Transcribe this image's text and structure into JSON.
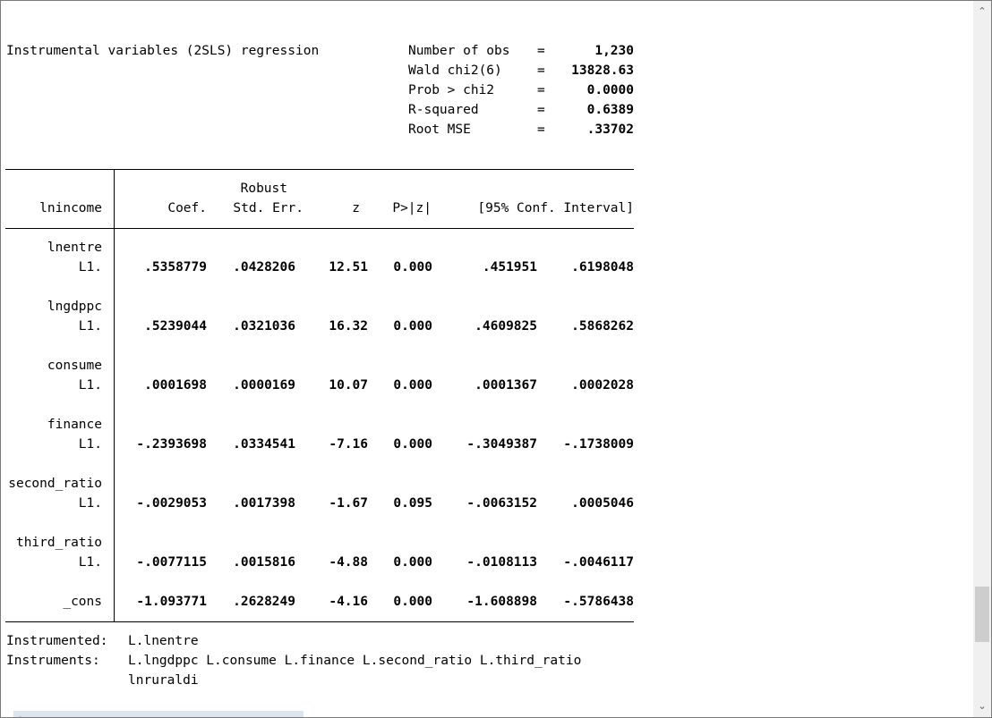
{
  "header": {
    "title": "Instrumental variables (2SLS) regression",
    "stats": [
      {
        "label": "Number of obs",
        "eq": "=",
        "value": "1,230"
      },
      {
        "label": "Wald chi2(6)",
        "eq": "=",
        "value": "13828.63"
      },
      {
        "label": "Prob > chi2",
        "eq": "=",
        "value": "0.0000"
      },
      {
        "label": "R-squared",
        "eq": "=",
        "value": "0.6389"
      },
      {
        "label": "Root MSE",
        "eq": "=",
        "value": ".33702"
      }
    ]
  },
  "table": {
    "depvar": "lnincome",
    "headers": {
      "robust": "Robust",
      "coef": "Coef.",
      "se": "Std. Err.",
      "z": "z",
      "p": "P>|z|",
      "ci": "[95% Conf. Interval]"
    },
    "rows": [
      {
        "var": "lnentre",
        "lag": "L1.",
        "coef": ".5358779",
        "se": ".0428206",
        "z": "12.51",
        "p": "0.000",
        "lo": ".451951",
        "hi": ".6198048"
      },
      {
        "var": "lngdppc",
        "lag": "L1.",
        "coef": ".5239044",
        "se": ".0321036",
        "z": "16.32",
        "p": "0.000",
        "lo": ".4609825",
        "hi": ".5868262"
      },
      {
        "var": "consume",
        "lag": "L1.",
        "coef": ".0001698",
        "se": ".0000169",
        "z": "10.07",
        "p": "0.000",
        "lo": ".0001367",
        "hi": ".0002028"
      },
      {
        "var": "finance",
        "lag": "L1.",
        "coef": "-.2393698",
        "se": ".0334541",
        "z": "-7.16",
        "p": "0.000",
        "lo": "-.3049387",
        "hi": "-.1738009"
      },
      {
        "var": "second_ratio",
        "lag": "L1.",
        "coef": "-.0029053",
        "se": ".0017398",
        "z": "-1.67",
        "p": "0.095",
        "lo": "-.0063152",
        "hi": ".0005046"
      },
      {
        "var": "third_ratio",
        "lag": "L1.",
        "coef": "-.0077115",
        "se": ".0015816",
        "z": "-4.88",
        "p": "0.000",
        "lo": "-.0108113",
        "hi": "-.0046117"
      }
    ],
    "cons": {
      "var": "_cons",
      "coef": "-1.093771",
      "se": ".2628249",
      "z": "-4.16",
      "p": "0.000",
      "lo": "-1.608898",
      "hi": "-.5786438"
    }
  },
  "footer": {
    "instrumented_label": "Instrumented:",
    "instrumented_value": "L.lnentre",
    "instruments_label": "Instruments:",
    "instruments_line1": "L.lngdppc L.consume L.finance L.second_ratio L.third_ratio",
    "instruments_line2": "lnruraldi"
  },
  "scrollbar": {
    "up_icon": "chevron-up-icon",
    "down_icon": "chevron-down-icon",
    "position_fraction": 0.87
  }
}
